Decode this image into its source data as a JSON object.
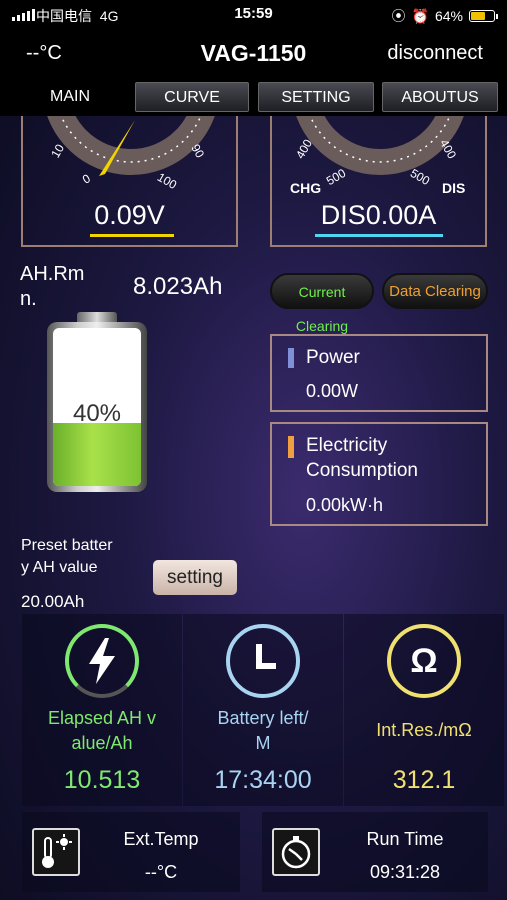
{
  "status_bar": {
    "carrier": "中国电信",
    "network": "4G",
    "time": "15:59",
    "battery_pct": "64%"
  },
  "header": {
    "temp": "--°C",
    "title": "VAG-1150",
    "disconnect": "disconnect"
  },
  "tabs": [
    {
      "label": "MAIN"
    },
    {
      "label": "CURVE"
    },
    {
      "label": "SETTING"
    },
    {
      "label": "ABOUTUS"
    }
  ],
  "voltage_gauge": {
    "ticks": [
      "10",
      "0",
      "90",
      "100"
    ],
    "value": "0.09V",
    "underline_color": "#f2d400"
  },
  "current_gauge": {
    "ticks": [
      "400",
      "500",
      "500",
      "400"
    ],
    "label_left": "CHG",
    "label_right": "DIS",
    "value": "DIS0.00A",
    "underline_color": "#4fd6f2"
  },
  "ah_remaining": {
    "label": "AH.Rm n.",
    "value": "8.023Ah"
  },
  "buttons": {
    "current_clearing": "Current Clearing",
    "data_clearing": "Data Clearing",
    "setting": "setting"
  },
  "battery": {
    "percent_text": "40%",
    "level": 0.4
  },
  "power": {
    "label": "Power",
    "value": "0.00W",
    "accent": "#7f8fd8"
  },
  "electricity": {
    "label_line1": "Electricity",
    "label_line2": "Consumption",
    "value": "0.00kW·h",
    "accent": "#f0a040"
  },
  "preset": {
    "label_line1": "Preset batter",
    "label_line2": "y AH value",
    "value": "20.00Ah"
  },
  "stats": [
    {
      "label_line1": "Elapsed AH v",
      "label_line2": "alue/Ah",
      "value": "10.513",
      "color": "#7fe870",
      "icon": "lightning-icon"
    },
    {
      "label_line1": "Battery left/",
      "label_line2": "M",
      "value": "17:34:00",
      "color": "#a8d4f2",
      "icon": "clock-icon"
    },
    {
      "label_line1": "Int.Res./mΩ",
      "label_line2": "",
      "value": "312.1",
      "color": "#f0e070",
      "icon": "ohm-icon"
    }
  ],
  "ext_temp": {
    "label": "Ext.Temp",
    "value": "--°C",
    "icon": "thermometer-icon"
  },
  "run_time": {
    "label": "Run Time",
    "value": "09:31:28",
    "icon": "stopwatch-icon"
  }
}
